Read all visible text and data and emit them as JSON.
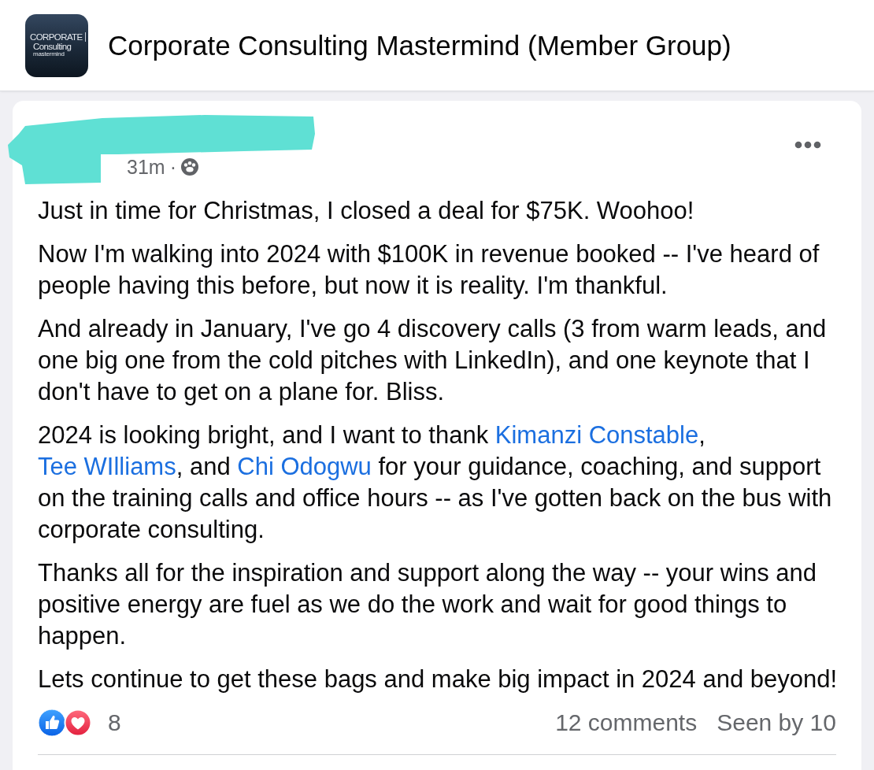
{
  "group": {
    "logo_lines": [
      "CORPORATE",
      "Consulting",
      "mastermind"
    ],
    "title": "Corporate Consulting Mastermind (Member Group)"
  },
  "post": {
    "time": "31m",
    "separator": "·",
    "paragraphs": [
      {
        "segments": [
          {
            "kind": "text",
            "text": "Just in time for Christmas, I closed a deal for $75K. Woohoo!"
          }
        ]
      },
      {
        "segments": [
          {
            "kind": "text",
            "text": "Now I'm walking into 2024 with $100K in revenue booked -- I've heard of people having this before, but now it is reality. I'm thankful."
          }
        ]
      },
      {
        "segments": [
          {
            "kind": "text",
            "text": "And already in January, I've go 4 discovery calls (3 from warm leads, and one big one from the cold pitches with LinkedIn), and one keynote that I don't have to get on a plane for. Bliss."
          }
        ]
      },
      {
        "segments": [
          {
            "kind": "text",
            "text": "2024 is looking bright, and I want to thank "
          },
          {
            "kind": "mention",
            "text": "Kimanzi Constable"
          },
          {
            "kind": "text",
            "text": ", "
          },
          {
            "kind": "mention",
            "text": "Tee WIlliams"
          },
          {
            "kind": "text",
            "text": ", and "
          },
          {
            "kind": "mention",
            "text": "Chi Odogwu"
          },
          {
            "kind": "text",
            "text": " for your guidance, coaching, and support on the training calls and office hours -- as I've gotten back on the bus with corporate consulting."
          }
        ]
      },
      {
        "segments": [
          {
            "kind": "text",
            "text": "Thanks all for the inspiration and support along the way -- your wins and positive energy are fuel as we do the work and wait for good things to happen."
          }
        ]
      },
      {
        "segments": [
          {
            "kind": "text",
            "text": "Lets continue to get these bags and make big impact in 2024 and beyond!"
          }
        ]
      }
    ],
    "reaction_count": "8",
    "comments": "12 comments",
    "seen_by": "Seen by 10"
  }
}
